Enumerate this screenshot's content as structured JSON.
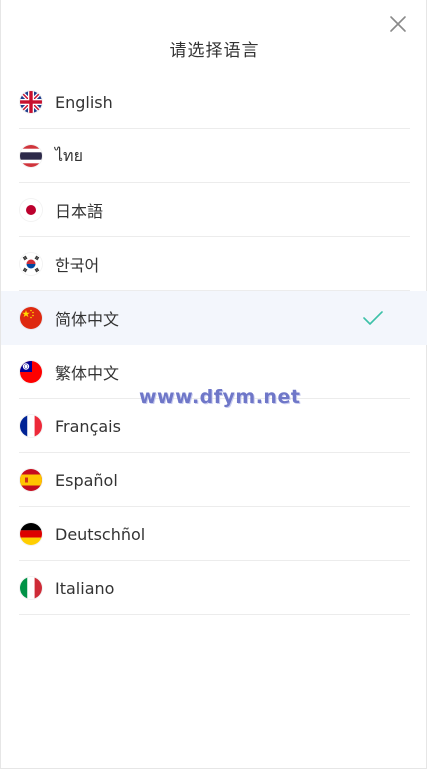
{
  "header": {
    "title": "请选择语言"
  },
  "languages": [
    {
      "label": "English",
      "flag": "uk-flag-icon"
    },
    {
      "label": "ไทย",
      "flag": "thailand-flag-icon"
    },
    {
      "label": "日本語",
      "flag": "japan-flag-icon"
    },
    {
      "label": "한국어",
      "flag": "korea-flag-icon"
    },
    {
      "label": "简体中文",
      "flag": "china-flag-icon",
      "selected": true
    },
    {
      "label": "繁体中文",
      "flag": "taiwan-flag-icon"
    },
    {
      "label": "Français",
      "flag": "france-flag-icon"
    },
    {
      "label": "Español",
      "flag": "spain-flag-icon"
    },
    {
      "label": "Deutschñol",
      "flag": "germany-flag-icon"
    },
    {
      "label": "Italiano",
      "flag": "italy-flag-icon"
    }
  ],
  "watermark": "www.dfym.net",
  "colors": {
    "accent": "#3cc1a8",
    "selected_bg": "#f3f6fc",
    "divider": "#ececec"
  }
}
